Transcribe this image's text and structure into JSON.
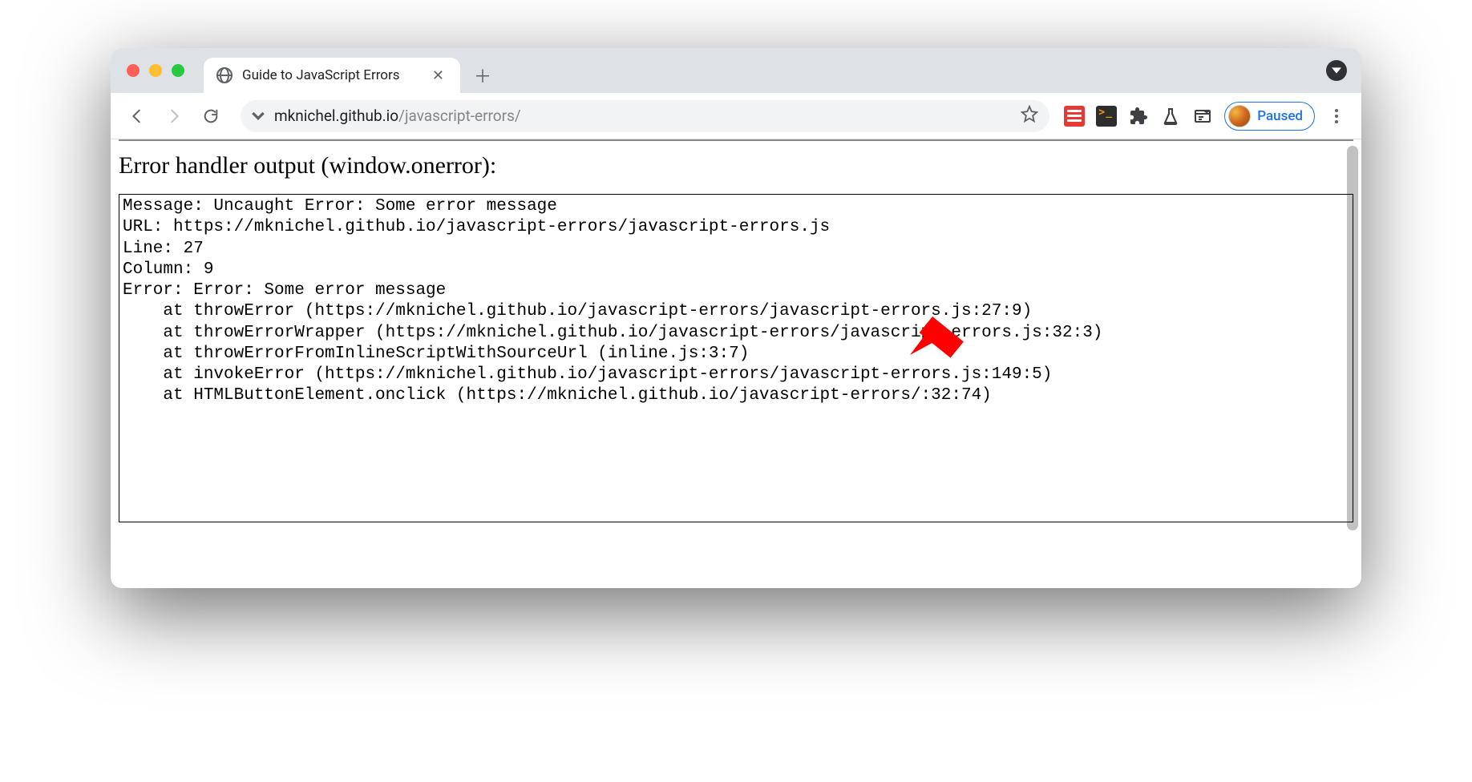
{
  "tab": {
    "title": "Guide to JavaScript Errors"
  },
  "url": {
    "host": "mknichel.github.io",
    "path": "/javascript-errors/"
  },
  "profile": {
    "status": "Paused"
  },
  "page": {
    "heading": "Error handler output (window.onerror):",
    "output": "Message: Uncaught Error: Some error message\nURL: https://mknichel.github.io/javascript-errors/javascript-errors.js\nLine: 27\nColumn: 9\nError: Error: Some error message\n    at throwError (https://mknichel.github.io/javascript-errors/javascript-errors.js:27:9)\n    at throwErrorWrapper (https://mknichel.github.io/javascript-errors/javascript-errors.js:32:3)\n    at throwErrorFromInlineScriptWithSourceUrl (inline.js:3:7)\n    at invokeError (https://mknichel.github.io/javascript-errors/javascript-errors.js:149:5)\n    at HTMLButtonElement.onclick (https://mknichel.github.io/javascript-errors/:32:74)"
  }
}
